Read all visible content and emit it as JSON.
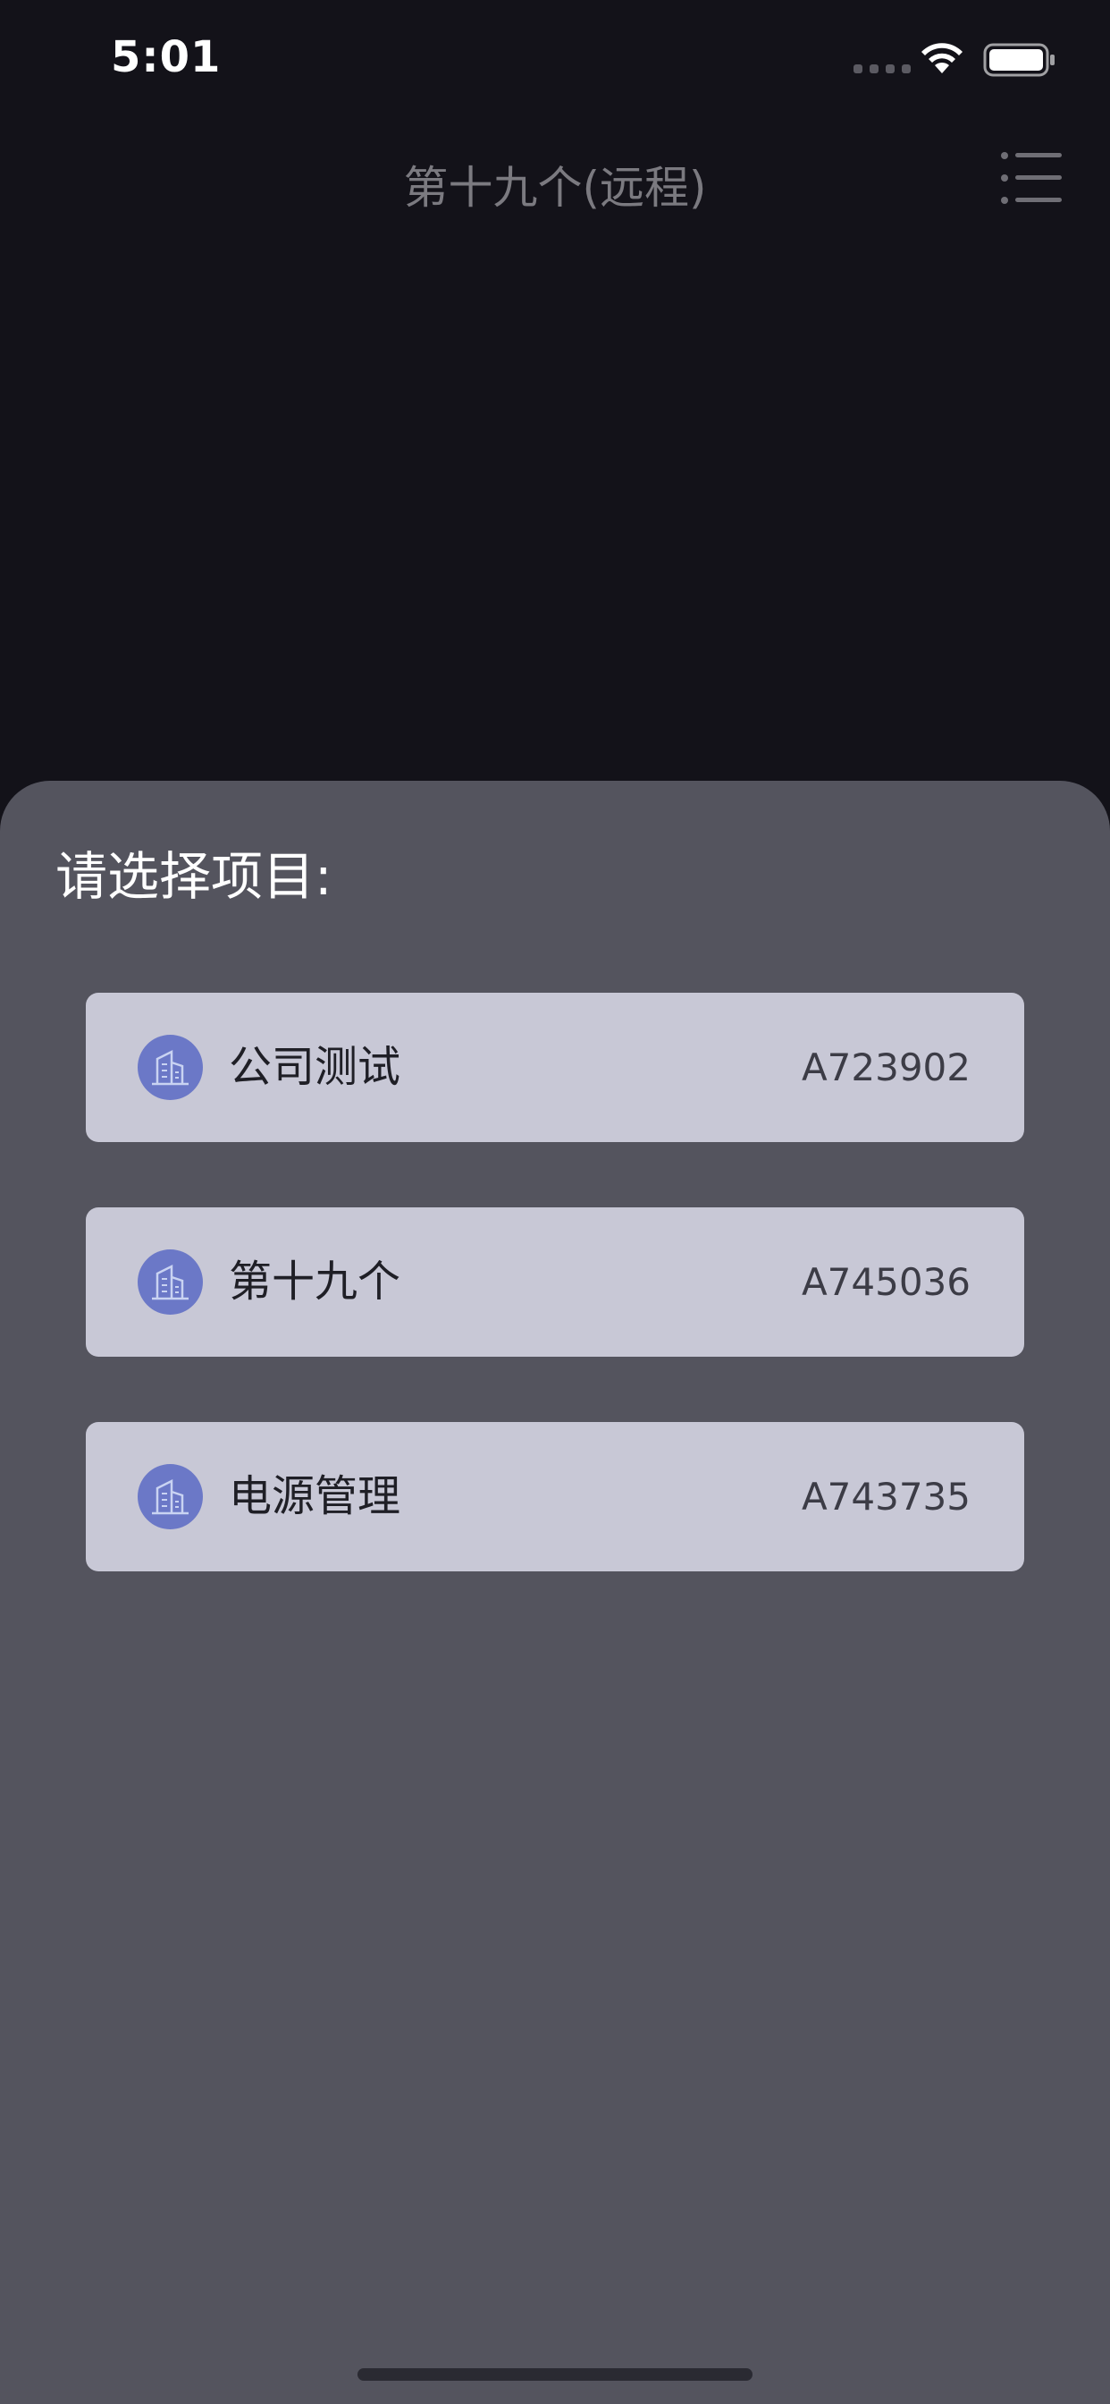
{
  "status_bar": {
    "time": "5:01"
  },
  "nav": {
    "title": "第十九个(远程)",
    "menu_icon": "list-menu-icon"
  },
  "sheet": {
    "title": "请选择项目:",
    "projects": [
      {
        "name": "公司测试",
        "code": "A723902",
        "icon": "building-icon"
      },
      {
        "name": "第十九个",
        "code": "A745036",
        "icon": "building-icon"
      },
      {
        "name": "电源管理",
        "code": "A743735",
        "icon": "building-icon"
      }
    ]
  },
  "colors": {
    "background": "#131219",
    "sheet": "#54545e",
    "card": "#c8c8d6",
    "icon_accent": "#6b78c7"
  }
}
